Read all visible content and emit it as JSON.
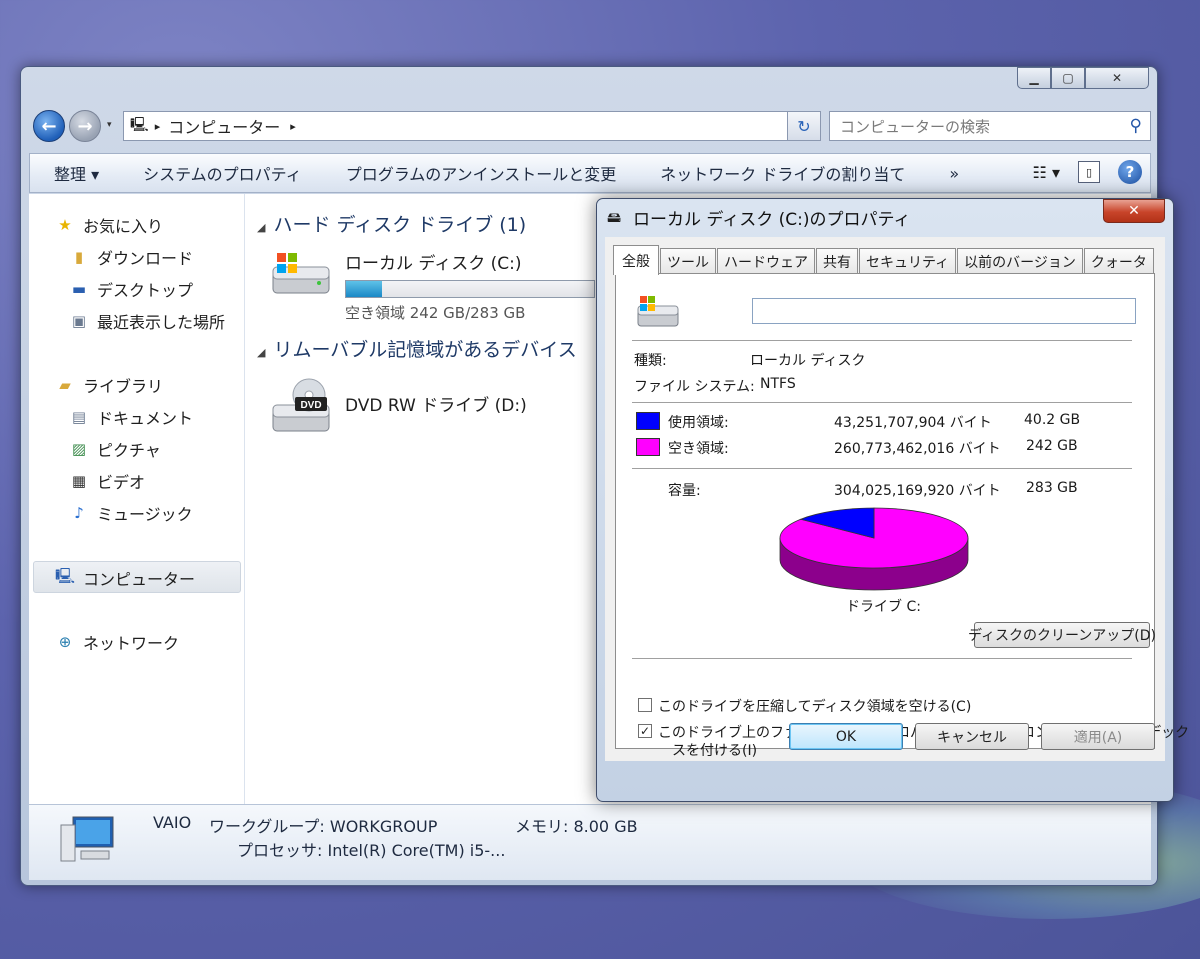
{
  "explorer": {
    "address": {
      "icon": "computer-icon",
      "separator": "▸",
      "location": "コンピューター"
    },
    "search": {
      "placeholder": "コンピューターの検索"
    },
    "commands": [
      "整理 ▾",
      "システムのプロパティ",
      "プログラムのアンインストールと変更",
      "ネットワーク ドライブの割り当て",
      "»"
    ],
    "sidebar": {
      "favorites": {
        "label": "お気に入り",
        "items": [
          "ダウンロード",
          "デスクトップ",
          "最近表示した場所"
        ]
      },
      "libraries": {
        "label": "ライブラリ",
        "items": [
          "ドキュメント",
          "ピクチャ",
          "ビデオ",
          "ミュージック"
        ]
      },
      "computer": "コンピューター",
      "network": "ネットワーク"
    },
    "groups": {
      "hard_disks": "ハード ディスク ドライブ (1)",
      "removable": "リムーバブル記憶域があるデバイス"
    },
    "drives": {
      "c": {
        "name": "ローカル ディスク (C:)",
        "free": "空き領域 242 GB/283 GB",
        "used_fraction": 0.145
      },
      "d": {
        "name": "DVD RW ドライブ (D:)",
        "badge": "DVD"
      }
    },
    "details": {
      "computer_name": "VAIO",
      "workgroup": "ワークグループ: WORKGROUP",
      "memory": "メモリ: 8.00 GB",
      "processor": "プロセッサ: Intel(R) Core(TM) i5-..."
    }
  },
  "dialog": {
    "title": "ローカル ディスク (C:)のプロパティ",
    "tabs": [
      "全般",
      "ツール",
      "ハードウェア",
      "共有",
      "セキュリティ",
      "以前のバージョン",
      "クォータ"
    ],
    "name_value": "",
    "type_label": "種類:",
    "type_value": "ローカル ディスク",
    "fs_label": "ファイル システム:",
    "fs_value": "NTFS",
    "used": {
      "label": "使用領域:",
      "bytes": "43,251,707,904 バイト",
      "size": "40.2 GB",
      "color": "#0000ff"
    },
    "free": {
      "label": "空き領域:",
      "bytes": "260,773,462,016 バイト",
      "size": "242 GB",
      "color": "#ff00ff"
    },
    "capacity": {
      "label": "容量:",
      "bytes": "304,025,169,920 バイト",
      "size": "283 GB"
    },
    "drive_label": "ドライブ C:",
    "cleanup_button": "ディスクのクリーンアップ(D)",
    "compress": {
      "label": "このドライブを圧縮してディスク領域を空ける(C)",
      "checked": false
    },
    "index": {
      "label_line1": "このドライブ上のファイルに対し、プロパティだけでなくコンテンツにもインデック",
      "label_line2": "スを付ける(I)",
      "checked": true
    },
    "buttons": {
      "ok": "OK",
      "cancel": "キャンセル",
      "apply": "適用(A)"
    }
  }
}
